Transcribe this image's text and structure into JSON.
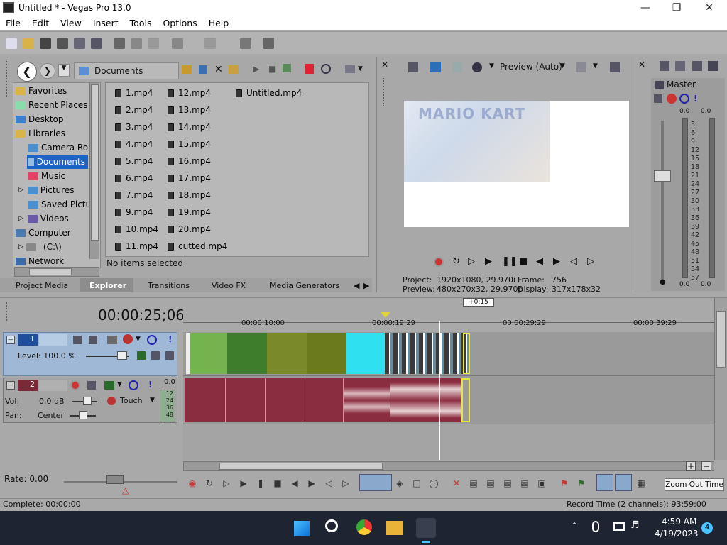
{
  "window": {
    "title": "Untitled * - Vegas Pro 13.0"
  },
  "menu": [
    "File",
    "Edit",
    "View",
    "Insert",
    "Tools",
    "Options",
    "Help"
  ],
  "explorer": {
    "path": "Documents",
    "tree": [
      "Favorites",
      "Recent Places",
      "Desktop",
      "Libraries",
      "Camera Roll",
      "Documents",
      "Music",
      "Pictures",
      "Saved Pictur",
      "Videos",
      "Computer",
      "(C:\\)",
      "Network"
    ],
    "files_col1": [
      "1.mp4",
      "2.mp4",
      "3.mp4",
      "4.mp4",
      "5.mp4",
      "6.mp4",
      "7.mp4",
      "9.mp4",
      "10.mp4",
      "11.mp4"
    ],
    "files_col2": [
      "12.mp4",
      "13.mp4",
      "14.mp4",
      "15.mp4",
      "16.mp4",
      "17.mp4",
      "18.mp4",
      "19.mp4",
      "20.mp4",
      "cutted.mp4"
    ],
    "files_col3": [
      "Untitled.mp4"
    ],
    "status": "No items selected"
  },
  "tabs": [
    "Project Media",
    "Explorer",
    "Transitions",
    "Video FX",
    "Media Generators"
  ],
  "preview": {
    "mode": "Preview (Auto)",
    "project_label": "Project:",
    "project_value": "1920x1080, 29.970i",
    "frame_label": "Frame:",
    "frame_value": "756",
    "preview_label": "Preview:",
    "preview_value": "480x270x32, 29.970p",
    "display_label": "Display:",
    "display_value": "317x178x32",
    "thumb_text": "MARIO KART"
  },
  "master": {
    "label": "Master",
    "left_val": "0.0",
    "right_val": "0.0",
    "bottom_left": "0.0",
    "bottom_right": "0.0",
    "scale": [
      "3",
      "6",
      "9",
      "12",
      "15",
      "18",
      "21",
      "24",
      "27",
      "30",
      "33",
      "36",
      "39",
      "42",
      "45",
      "48",
      "51",
      "54",
      "57"
    ]
  },
  "timeline": {
    "timecode": "00:00:25;06",
    "offset": "+0:15",
    "ticks": [
      "00:00:10:00",
      "00:00:19:29",
      "00:00:29:29",
      "00:00:39:29"
    ],
    "rate": "Rate: 0.00",
    "complete": "Complete: 00:00:00",
    "record_time": "Record Time (2 channels): 93:59:00",
    "tooltip": "Zoom Out Time"
  },
  "track1": {
    "num": "1",
    "level": "Level: 100.0 %"
  },
  "track2": {
    "num": "2",
    "vol_label": "Vol:",
    "vol": "0.0 dB",
    "pan_label": "Pan:",
    "pan": "Center",
    "mode": "Touch",
    "meter": [
      "0.0",
      "12",
      "24",
      "36",
      "48"
    ]
  },
  "taskbar": {
    "time": "4:59 AM",
    "date": "4/19/2023",
    "badge": "4"
  }
}
